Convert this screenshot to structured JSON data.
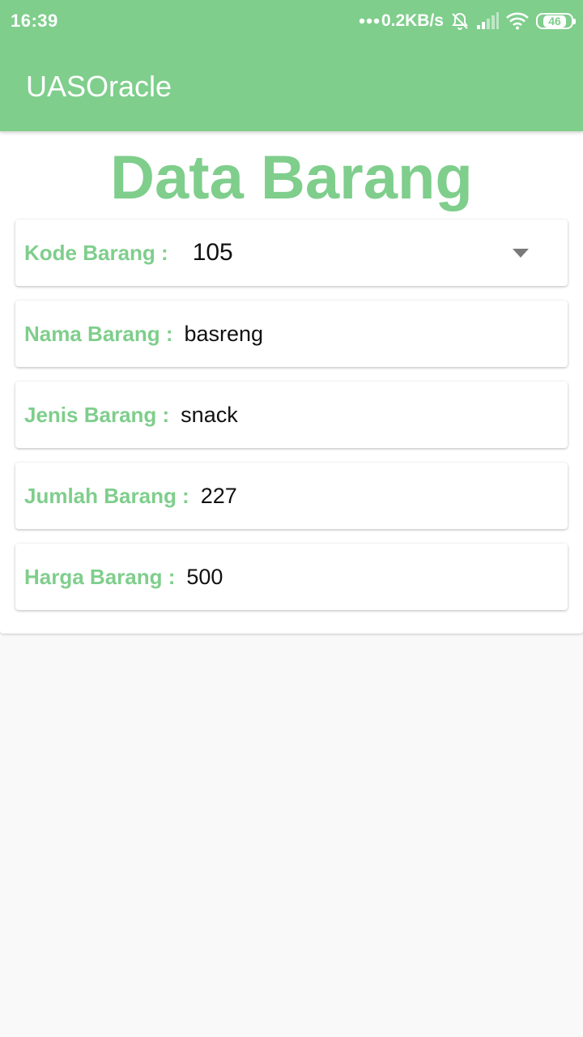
{
  "status_bar": {
    "time": "16:39",
    "network_speed": "0.2KB/s",
    "icons": [
      "dots-icon",
      "mute-bell-icon",
      "signal-icon",
      "wifi-icon",
      "battery-icon"
    ],
    "battery_level": "46"
  },
  "app_bar": {
    "title": "UASOracle",
    "color": "#7fce8c"
  },
  "main": {
    "heading": "Data Barang",
    "fields": [
      {
        "label": "Kode Barang :",
        "value": "105",
        "type": "dropdown"
      },
      {
        "label": "Nama Barang :",
        "value": "basreng",
        "type": "text"
      },
      {
        "label": "Jenis Barang :",
        "value": "snack",
        "type": "text"
      },
      {
        "label": "Jumlah Barang :",
        "value": "227",
        "type": "text"
      },
      {
        "label": "Harga Barang :",
        "value": "500",
        "type": "text"
      }
    ]
  }
}
